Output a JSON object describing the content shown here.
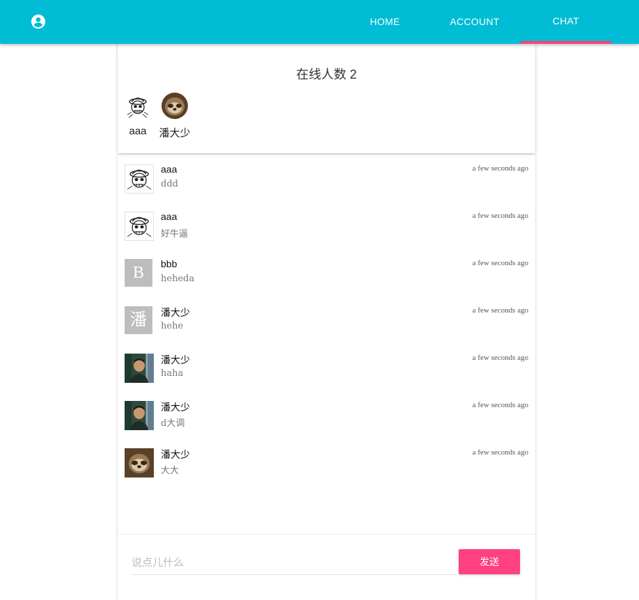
{
  "nav": {
    "tabs": [
      {
        "label": "HOME"
      },
      {
        "label": "ACCOUNT"
      },
      {
        "label": "CHAT"
      }
    ],
    "active_tab": "CHAT",
    "brand_color": "#00bcd4",
    "accent_color": "#ff4081"
  },
  "online": {
    "title": "在线人数 2",
    "users": [
      {
        "name": "aaa",
        "avatar": "skull-sketch-avatar"
      },
      {
        "name": "潘大少",
        "avatar": "sloth-avatar"
      }
    ]
  },
  "messages": [
    {
      "name": "aaa",
      "text": "ddd",
      "time": "a few seconds ago",
      "avatar": "skull-sketch-avatar"
    },
    {
      "name": "aaa",
      "text": "好牛逼",
      "time": "a few seconds ago",
      "avatar": "skull-sketch-avatar"
    },
    {
      "name": "bbb",
      "text": "heheda",
      "time": "a few seconds ago",
      "avatar": "letter",
      "avatar_letter": "B"
    },
    {
      "name": "潘大少",
      "text": "hehe",
      "time": "a few seconds ago",
      "avatar": "letter",
      "avatar_letter": "潘"
    },
    {
      "name": "潘大少",
      "text": "haha",
      "time": "a few seconds ago",
      "avatar": "boy-photo-avatar"
    },
    {
      "name": "潘大少",
      "text": "d大调",
      "time": "a few seconds ago",
      "avatar": "boy-photo-avatar"
    },
    {
      "name": "潘大少",
      "text": "大大",
      "time": "a few seconds ago",
      "avatar": "sloth-avatar"
    }
  ],
  "composer": {
    "placeholder": "说点儿什么",
    "value": "",
    "send_label": "发送"
  }
}
